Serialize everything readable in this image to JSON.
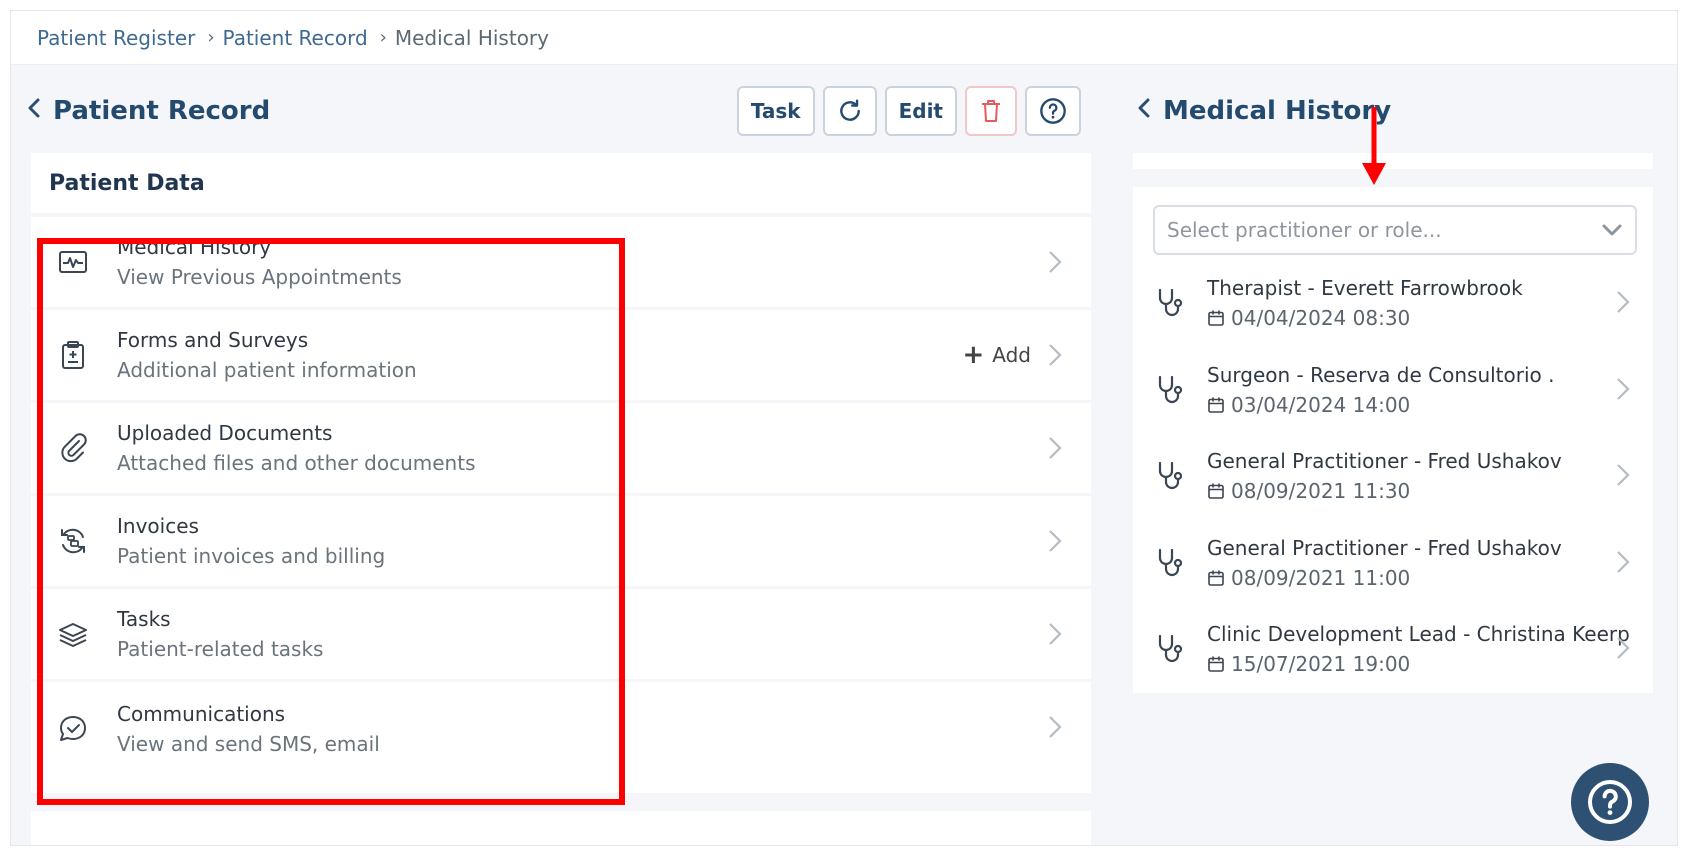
{
  "breadcrumb": [
    "Patient Register",
    "Patient Record",
    "Medical History"
  ],
  "left": {
    "title": "Patient Record",
    "toolbar": {
      "task": "Task",
      "edit": "Edit"
    },
    "card_title": "Patient Data",
    "items": [
      {
        "title": "Medical History",
        "subtitle": "View Previous Appointments",
        "icon": "heartbeat-monitor-icon"
      },
      {
        "title": "Forms and Surveys",
        "subtitle": "Additional patient information",
        "icon": "clipboard-plus-icon",
        "action": "Add"
      },
      {
        "title": "Uploaded Documents",
        "subtitle": "Attached files and other documents",
        "icon": "paperclip-icon"
      },
      {
        "title": "Invoices",
        "subtitle": "Patient invoices and billing",
        "icon": "invoice-cycle-icon"
      },
      {
        "title": "Tasks",
        "subtitle": "Patient-related tasks",
        "icon": "layers-icon"
      },
      {
        "title": "Communications",
        "subtitle": "View and send SMS, email",
        "icon": "chat-check-icon"
      }
    ]
  },
  "right": {
    "title": "Medical History",
    "select_placeholder": "Select practitioner or role...",
    "appointments": [
      {
        "title": "Therapist - Everett Farrowbrook",
        "date": "04/04/2024 08:30"
      },
      {
        "title": "Surgeon - Reserva de Consultorio .",
        "date": "03/04/2024 14:00"
      },
      {
        "title": "General Practitioner - Fred Ushakov",
        "date": "08/09/2021 11:30"
      },
      {
        "title": "General Practitioner - Fred Ushakov",
        "date": "08/09/2021 11:00"
      },
      {
        "title": "Clinic Development Lead - Christina Keerp",
        "date": "15/07/2021 19:00"
      }
    ]
  },
  "colors": {
    "accent": "#244a6e",
    "highlight": "#ff0000",
    "danger": "#e45b5b",
    "fab": "#2d5073"
  }
}
